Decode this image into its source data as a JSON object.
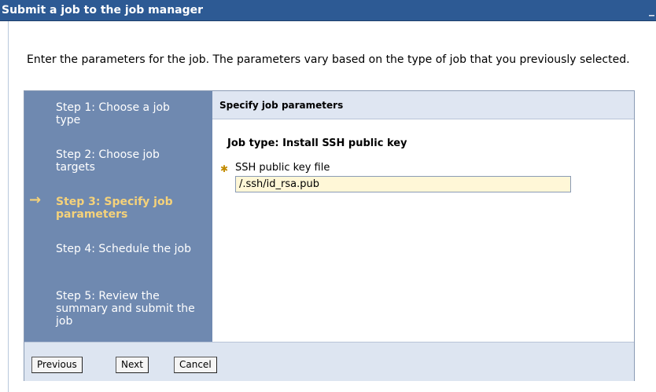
{
  "window": {
    "title": "Submit a job to the job manager",
    "minimize_glyph": "_"
  },
  "intro_text": "Enter the parameters for the job. The parameters vary based on the type of job that you previously selected.",
  "steps": [
    {
      "label": "Step 1: Choose a job type"
    },
    {
      "label": "Step 2: Choose job targets"
    },
    {
      "label": "Step 3: Specify job parameters",
      "current": true
    },
    {
      "label": "Step 4: Schedule the job"
    },
    {
      "label": "Step 5: Review the summary and submit the job"
    }
  ],
  "current_step_arrow": "→",
  "panel": {
    "heading": "Specify job parameters",
    "job_type": "Job type: Install SSH public key",
    "required_marker": "✱",
    "field_label": "SSH public key file",
    "field_value": "/.ssh/id_rsa.pub"
  },
  "buttons": {
    "previous": "Previous",
    "next": "Next",
    "cancel": "Cancel"
  },
  "colors": {
    "title_bar": "#2d5a94",
    "steps_background": "#6f89b0",
    "current_step": "#f5d27a",
    "field_background": "#fff7d7"
  }
}
